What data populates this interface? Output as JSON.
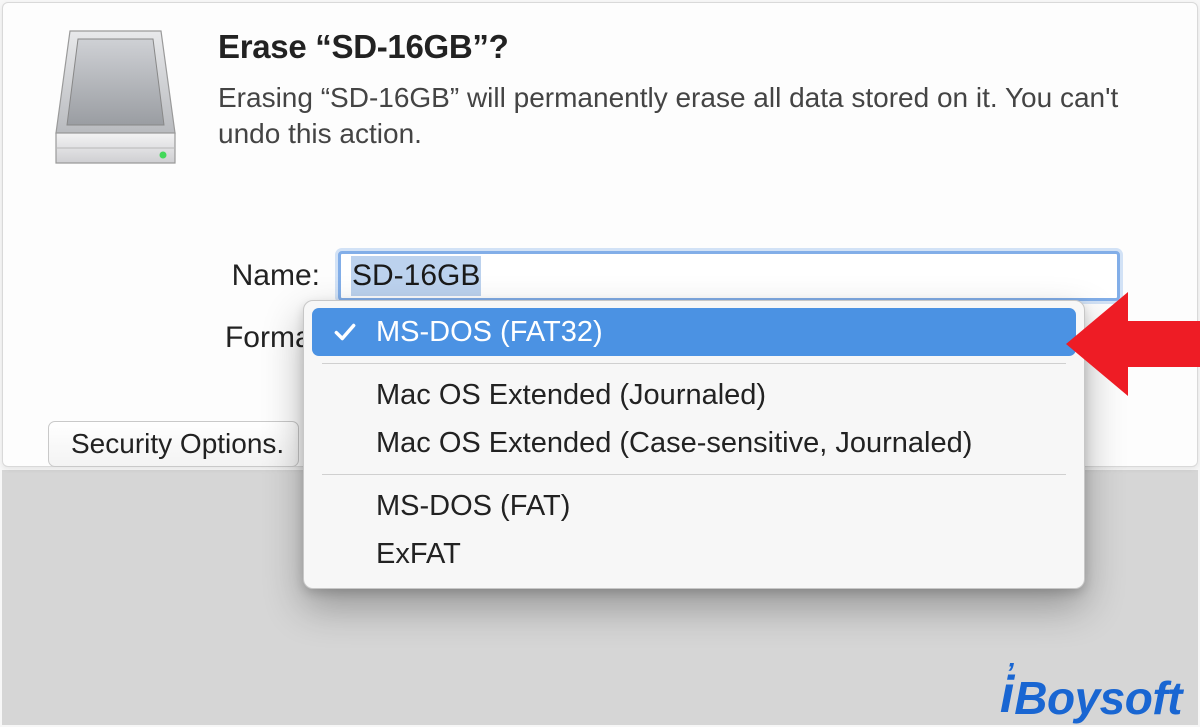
{
  "dialog": {
    "title": "Erase “SD-16GB”?",
    "description": "Erasing “SD-16GB” will permanently erase all data stored on it. You can't undo this action."
  },
  "form": {
    "name_label": "Name:",
    "name_value": "SD-16GB",
    "format_label": "Format"
  },
  "security_button_label": "Security Options.",
  "format_dropdown": {
    "selected_index": 0,
    "groups": [
      [
        "MS-DOS (FAT32)"
      ],
      [
        "Mac OS Extended (Journaled)",
        "Mac OS Extended (Case-sensitive, Journaled)"
      ],
      [
        "MS-DOS (FAT)",
        "ExFAT"
      ]
    ]
  },
  "colors": {
    "accent": "#4b92e3",
    "focus_ring": "#82aee8",
    "annotation_red": "#ee1c25",
    "brand_blue": "#1966d2"
  },
  "watermark": {
    "i": "i",
    "text": "Boysoft"
  }
}
